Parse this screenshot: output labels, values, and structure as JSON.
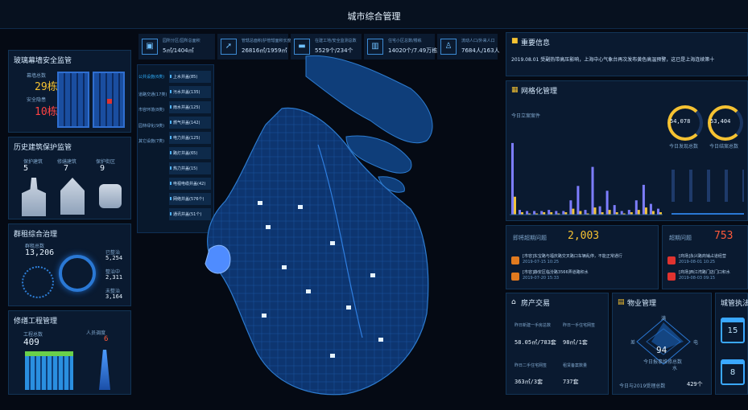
{
  "app": {
    "title": "城市综合管理"
  },
  "stats": [
    {
      "icon": "building-icon",
      "label": "园所分区/园所总面积",
      "value": "5㎡/1404㎡"
    },
    {
      "icon": "road-icon",
      "label": "管辖总面积/护管辖面积长度",
      "value": "26816㎡/1959㎡"
    },
    {
      "icon": "bed-icon",
      "label": "在建工地/安全监测总数",
      "value": "5529个/234个"
    },
    {
      "icon": "city-icon",
      "label": "住宅小区总数/楼栋",
      "value": "14020个/7.49万栋"
    },
    {
      "icon": "person-icon",
      "label": "流动人口/外来人口",
      "value": "7684人/163人"
    }
  ],
  "categories": [
    "公共设施(6类)",
    "道路交通(17类)",
    "市容环境(8类)",
    "园林绿化(9类)",
    "其它设施(7类)"
  ],
  "subitems": [
    "上水井盖(85)",
    "污水井盖(135)",
    "雨水井盖(125)",
    "燃气井盖(142)",
    "电力井盖(125)",
    "路灯井盖(65)",
    "热力井盖(15)",
    "电视电缆井盖(42)",
    "网络井盖(576个)",
    "通讯井盖(51个)"
  ],
  "left": {
    "p1": {
      "title": "玻璃幕墙安全监管",
      "l1": "幕墙总数",
      "v1": "29栋",
      "l2": "安全隐患",
      "v2": "10栋"
    },
    "p2": {
      "title": "历史建筑保护监管",
      "items": [
        {
          "label": "保护建筑",
          "value": "5"
        },
        {
          "label": "修缮建筑",
          "value": "7"
        },
        {
          "label": "保护街区",
          "value": "9"
        }
      ]
    },
    "p3": {
      "title": "群租综合治理",
      "l1": "群租总数",
      "v1": "13,206",
      "s": [
        {
          "l": "已整治",
          "v": "5,254"
        },
        {
          "l": "整治中",
          "v": "2,311"
        },
        {
          "l": "未整治",
          "v": "3,164"
        }
      ]
    },
    "p4": {
      "title": "修缮工程管理",
      "l1": "工程总数",
      "v1": "409",
      "l2": "人员调度",
      "v2": "6"
    }
  },
  "right": {
    "info": {
      "title": "重要信息",
      "text": "2019.08.01 受副热带高压影响，上海中心气象台再次发布黄色高温预警，这已是上海连续第十"
    },
    "grid": {
      "title": "网格化管理",
      "chart_title": "今日立案案件",
      "gauge1": "54,078",
      "gauge1_label": "今日发现总数",
      "gauge2": "53,404",
      "gauge2_label": "今日结案总数"
    },
    "prob1": {
      "label": "即将超期问题",
      "value": "2,003",
      "rows": [
        {
          "text": "[市容]东宝路与福庆路交叉路口车辆乱停，不能正常通行",
          "time": "2019-07-15 10:25"
        },
        {
          "text": "[市容]静安区临汾路3566弄道路积水",
          "time": "2019-07-20 15:33"
        }
      ]
    },
    "prob2": {
      "label": "超期问题",
      "value": "753",
      "rows": [
        {
          "text": "[商场]永兴路商铺占道经营",
          "time": "2019-08-01 10:25"
        },
        {
          "text": "[商场]西江湾路门店门口积水",
          "time": "2019-08-03 09:15"
        }
      ]
    },
    "house": {
      "title": "房产交易",
      "l1": "昨日新建一手房总数",
      "l2": "昨日一手住宅网签",
      "v1": "58.05㎡/783套",
      "v2": "98㎡/1套",
      "l3": "昨日二手住宅网签",
      "l4": "租赁备案数量",
      "v3": "363㎡/3套",
      "v4": "737套"
    },
    "property": {
      "title": "物业管理",
      "center": "94",
      "center_label": "今日报事维修总数",
      "n": "满",
      "w": "差",
      "e": "电",
      "s": "水",
      "foot1": "今日与2019受理总数",
      "foot2": "429个"
    },
    "city": {
      "title": "城管执法",
      "c1": "15",
      "c2": "8"
    }
  },
  "chart_data": {
    "type": "bar",
    "title": "今日立案案件",
    "series": [
      {
        "name": "",
        "color": "#7d7dff",
        "values": [
          60,
          4,
          3,
          3,
          3,
          4,
          3,
          3,
          12,
          24,
          4,
          40,
          7,
          20,
          8,
          3,
          4,
          12,
          25,
          9,
          5
        ]
      },
      {
        "name": "",
        "color": "#f0c43a",
        "values": [
          15,
          2,
          1,
          1,
          2,
          2,
          1,
          2,
          5,
          3,
          1,
          6,
          2,
          4,
          2,
          1,
          2,
          4,
          6,
          3,
          2
        ]
      }
    ]
  }
}
